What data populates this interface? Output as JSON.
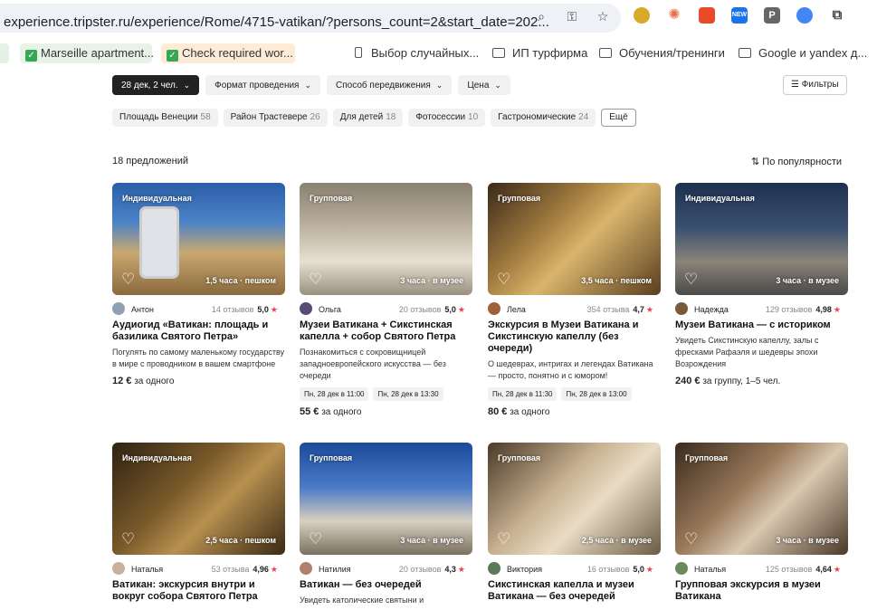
{
  "browser": {
    "url": "experience.tripster.ru/experience/Rome/4715-vatikan/?persons_count=2&start_date=202...",
    "bookmarks": [
      {
        "label": "Marseille apartment..."
      },
      {
        "label": "Check required wor..."
      },
      {
        "label": "Выбор случайных..."
      },
      {
        "label": "ИП турфирма"
      },
      {
        "label": "Обучения/тренинги"
      },
      {
        "label": "Google и yandex д..."
      }
    ],
    "extension_new_label": "NEW",
    "extension_p_label": "P"
  },
  "filters": {
    "date": "28 дек, 2 чел.",
    "format": "Формат проведения",
    "transport": "Способ передвижения",
    "price": "Цена",
    "all_filters": "Фильтры"
  },
  "tags": [
    {
      "label": "Площадь Венеции",
      "count": "58"
    },
    {
      "label": "Район Трастевере",
      "count": "26"
    },
    {
      "label": "Для детей",
      "count": "18"
    },
    {
      "label": "Фотосессии",
      "count": "10"
    },
    {
      "label": "Гастрономические",
      "count": "24"
    }
  ],
  "more_label": "Ещё",
  "results_count": "18 предложений",
  "sort_label": "По популярности",
  "cards": [
    {
      "badge": "Индивидуальная",
      "duration": "1,5 часа · пешком",
      "guide": "Антон",
      "reviews": "14 отзывов",
      "rating": "5,0",
      "title": "Аудиогид «Ватикан: площадь и базилика Святого Петра»",
      "desc": "Погулять по самому маленькому государству в мире с проводником в вашем смартфоне",
      "slots": [],
      "price": "12 €",
      "price_note": "за одного"
    },
    {
      "badge": "Групповая",
      "duration": "3 часа · в музее",
      "guide": "Ольга",
      "reviews": "20 отзывов",
      "rating": "5,0",
      "title": "Музеи Ватикана + Сикстинская капелла + собор Святого Петра",
      "desc": "Познакомиться с сокровищницей западноевропейского искусства — без очереди",
      "slots": [
        "Пн, 28 дек в 11:00",
        "Пн, 28 дек в 13:30"
      ],
      "price": "55 €",
      "price_note": "за одного"
    },
    {
      "badge": "Групповая",
      "duration": "3,5 часа · пешком",
      "guide": "Лела",
      "reviews": "354 отзыва",
      "rating": "4,7",
      "title": "Экскурсия в Музеи Ватикана и Сикстинскую капеллу (без очереди)",
      "desc": "О шедеврах, интригах и легендах Ватикана — просто, понятно и с юмором!",
      "slots": [
        "Пн, 28 дек в 11:30",
        "Пн, 28 дек в 13:00"
      ],
      "price": "80 €",
      "price_note": "за одного"
    },
    {
      "badge": "Индивидуальная",
      "duration": "3 часа · в музее",
      "guide": "Надежда",
      "reviews": "129 отзывов",
      "rating": "4,98",
      "title": "Музеи Ватикана — с историком",
      "desc": "Увидеть Сикстинскую капеллу, залы с фресками Рафаэля и шедевры эпохи Возрождения",
      "slots": [],
      "price": "240 €",
      "price_note": "за группу, 1–5 чел."
    },
    {
      "badge": "Индивидуальная",
      "duration": "2,5 часа · пешком",
      "guide": "Наталья",
      "reviews": "53 отзыва",
      "rating": "4,96",
      "title": "Ватикан: экскурсия внутри и вокруг собора Святого Петра",
      "desc": "",
      "slots": [],
      "price": "",
      "price_note": ""
    },
    {
      "badge": "Групповая",
      "duration": "3 часа · в музее",
      "guide": "Натилия",
      "reviews": "20 отзывов",
      "rating": "4,3",
      "title": "Ватикан — без очередей",
      "desc": "Увидеть католические святыни и",
      "slots": [],
      "price": "",
      "price_note": ""
    },
    {
      "badge": "Групповая",
      "duration": "2,5 часа · в музее",
      "guide": "Виктория",
      "reviews": "16 отзывов",
      "rating": "5,0",
      "title": "Сикстинская капелла и музеи Ватикана — без очередей",
      "desc": "",
      "slots": [],
      "price": "",
      "price_note": ""
    },
    {
      "badge": "Групповая",
      "duration": "3 часа · в музее",
      "guide": "Наталья",
      "reviews": "125 отзывов",
      "rating": "4,64",
      "title": "Групповая экскурсия в музеи Ватикана",
      "desc": "",
      "slots": [],
      "price": "",
      "price_note": ""
    }
  ]
}
